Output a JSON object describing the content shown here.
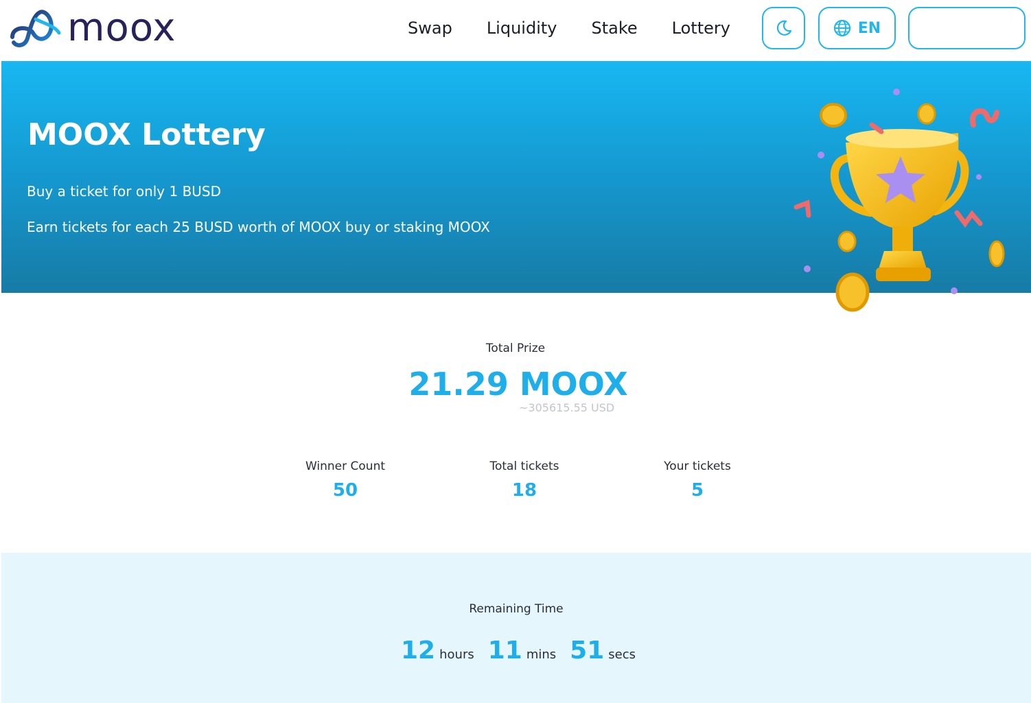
{
  "header": {
    "logo_text": "moox",
    "nav": [
      {
        "label": "Swap"
      },
      {
        "label": "Liquidity"
      },
      {
        "label": "Stake"
      },
      {
        "label": "Lottery"
      }
    ],
    "theme_icon": "moon-icon",
    "language_icon": "globe-icon",
    "language_label": "EN",
    "wallet_label": ""
  },
  "hero": {
    "title": "MOOX Lottery",
    "line1": "Buy a ticket for only 1 BUSD",
    "line2": "Earn tickets for each 25 BUSD worth of MOOX buy or staking MOOX",
    "image_icon": "trophy-icon"
  },
  "prize": {
    "label": "Total Prize",
    "value": "21.29 MOOX",
    "usd": "~305615.55 USD"
  },
  "stats": {
    "winner_label": "Winner Count",
    "winner_value": "50",
    "total_label": "Total tickets",
    "total_value": "18",
    "your_label": "Your tickets",
    "your_value": "5"
  },
  "countdown": {
    "label": "Remaining Time",
    "hours": "12",
    "hours_unit": "hours",
    "mins": "11",
    "mins_unit": "mins",
    "secs": "51",
    "secs_unit": "secs"
  },
  "colors": {
    "accent": "#1eaeea",
    "brand_dark": "#27235a",
    "hero_top": "#18b7f2",
    "hero_bottom": "#177ba5",
    "countdown_bg": "#e6f6fd"
  }
}
